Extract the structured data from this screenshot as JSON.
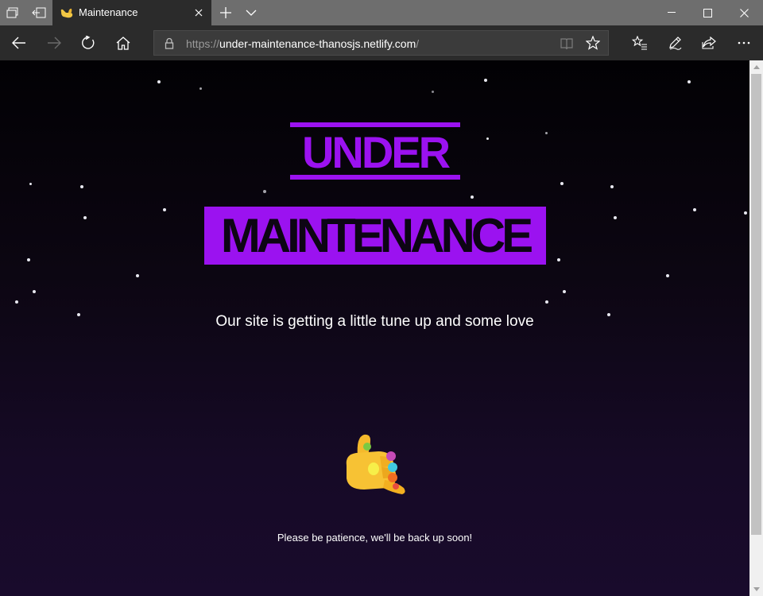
{
  "browser": {
    "tab": {
      "title": "Maintenance",
      "favicon": "call-me-hand-icon"
    },
    "address": {
      "scheme": "https://",
      "host": "under-maintenance-thanosjs.netlify.com",
      "path": "/"
    },
    "icons": {
      "tab_actions": "tab-list-icon",
      "set_aside": "set-aside-tabs-icon",
      "new_tab": "plus-icon",
      "tab_menu": "chevron-down-icon",
      "back": "back-arrow-icon",
      "forward": "forward-arrow-icon",
      "refresh": "refresh-icon",
      "home": "home-icon",
      "reading_view": "reading-view-icon",
      "favorite": "star-icon",
      "favorites_hub": "favorites-list-icon",
      "notes": "pen-icon",
      "share": "share-icon",
      "more": "more-icon"
    }
  },
  "page": {
    "heading_top": "UNDER",
    "heading_bottom": "MAINTENANCE",
    "tagline": "Our site is getting a little tune up and some love",
    "footer_note": "Please be patience, we'll be back up soon!",
    "emoji": "infinity-gauntlet-hand-icon",
    "colors": {
      "accent": "#9b12f0",
      "background": "#0b0612",
      "text": "#ffffff"
    }
  }
}
